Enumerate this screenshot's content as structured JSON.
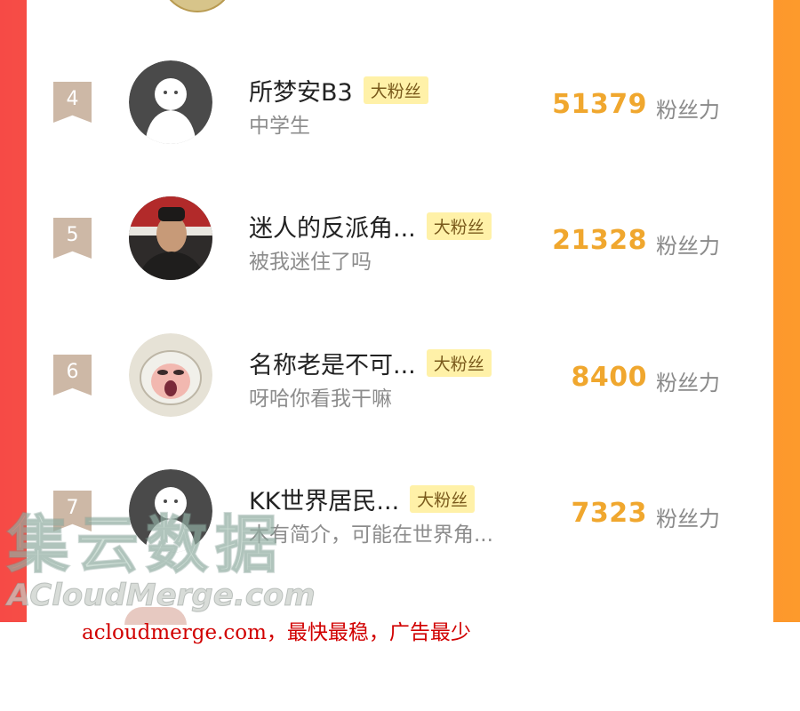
{
  "ranking": {
    "unit_label": "粉丝力",
    "tag_label": "大粉丝",
    "rows": [
      {
        "rank": "4",
        "name": "所梦安B3",
        "bio": "中学生",
        "score": "51379",
        "avatar": "ghost-default"
      },
      {
        "rank": "5",
        "name": "迷人的反派角...",
        "bio": "被我迷住了吗",
        "score": "21328",
        "avatar": "photo-man"
      },
      {
        "rank": "6",
        "name": "名称老是不可...",
        "bio": "呀哈你看我干嘛",
        "score": "8400",
        "avatar": "cartoon-sheep"
      },
      {
        "rank": "7",
        "name": "KK世界居民...",
        "bio": "木有简介，可能在世界角...",
        "score": "7323",
        "avatar": "ghost-default"
      }
    ]
  },
  "watermark": {
    "text_cn": "集云数据",
    "text_en": "ACloudMerge.com",
    "caption": "acloudmerge.com，最快最稳，广告最少"
  },
  "colors": {
    "gradient_start": "#f64a46",
    "gradient_end": "#fd9a2c",
    "score": "#f0a72e",
    "tag_bg": "#fff1a8",
    "badge": "#cdb8a6",
    "caption": "#d10000"
  }
}
